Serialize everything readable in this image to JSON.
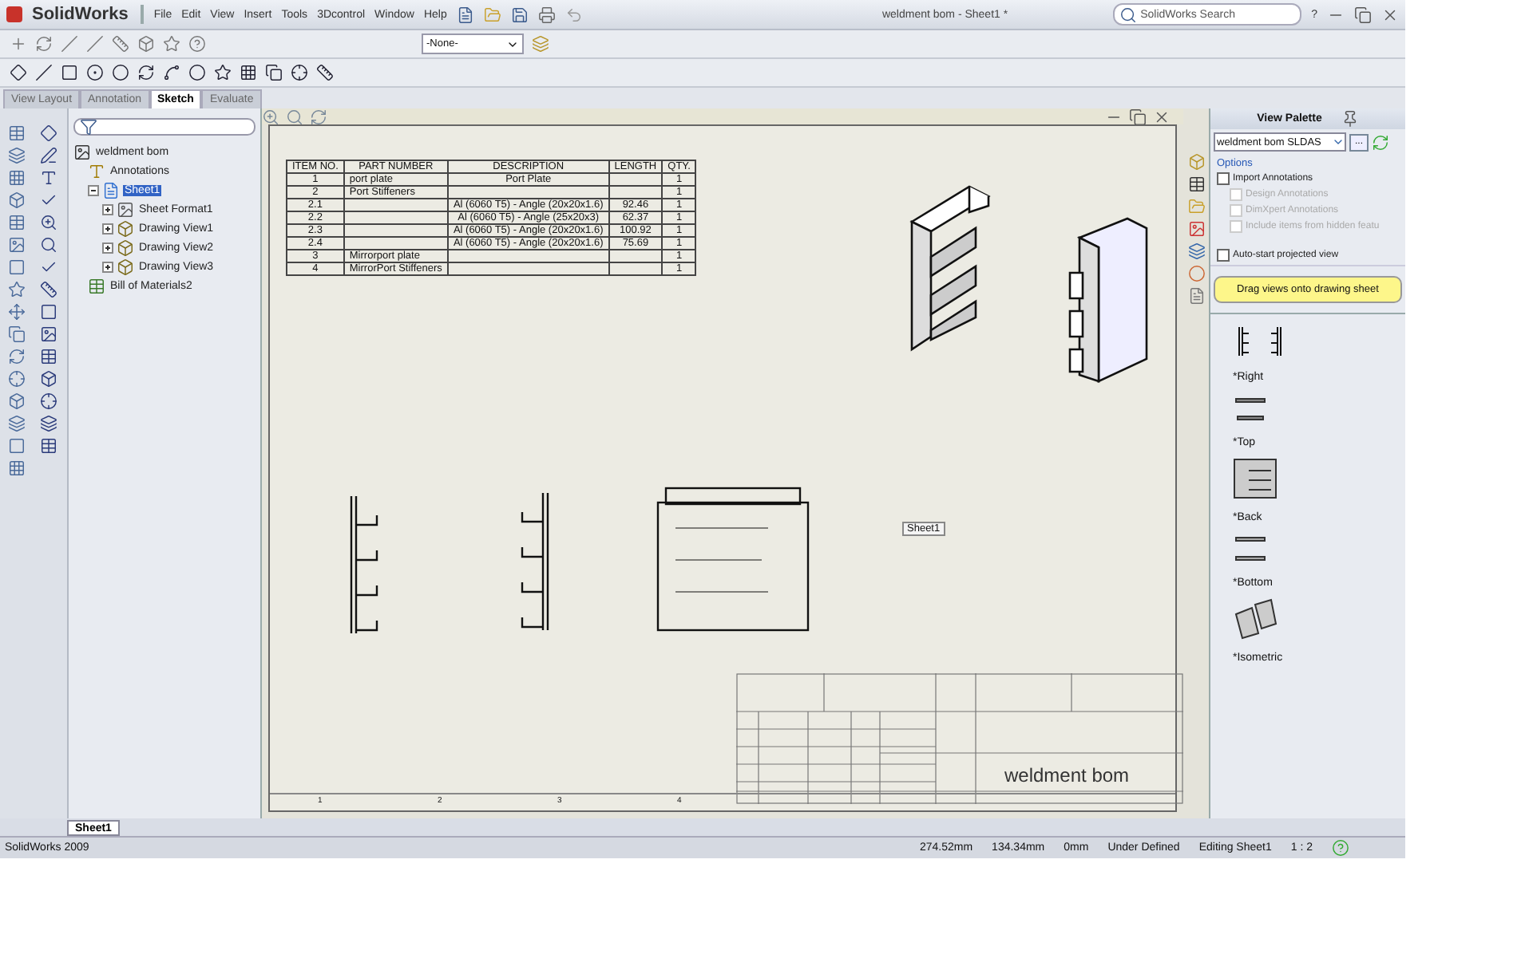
{
  "app": {
    "logo": "SolidWorks",
    "menus": [
      "File",
      "Edit",
      "View",
      "Insert",
      "Tools",
      "3Dcontrol",
      "Window",
      "Help"
    ],
    "document_title": "weldment bom - Sheet1 *",
    "search": {
      "placeholder": "SolidWorks Search"
    },
    "help": "?"
  },
  "layer_dropdown": {
    "value": "-None-"
  },
  "command_tabs": [
    {
      "label": "View Layout",
      "selected": false
    },
    {
      "label": "Annotation",
      "selected": false
    },
    {
      "label": "Sketch",
      "selected": true
    },
    {
      "label": "Evaluate",
      "selected": false
    }
  ],
  "feature_tree": {
    "root": "weldment bom",
    "items": [
      {
        "label": "Annotations",
        "kind": "annotations",
        "selected": false
      },
      {
        "label": "Sheet1",
        "kind": "sheet",
        "selected": true,
        "expanded": true,
        "children": [
          {
            "label": "Sheet Format1",
            "kind": "sheet_format",
            "selected": false,
            "expanded": false
          },
          {
            "label": "Drawing View1",
            "kind": "drawing_view",
            "selected": false,
            "expanded": false
          },
          {
            "label": "Drawing View2",
            "kind": "drawing_view",
            "selected": false,
            "expanded": false
          },
          {
            "label": "Drawing View3",
            "kind": "drawing_view",
            "selected": false,
            "expanded": false
          }
        ]
      },
      {
        "label": "Bill of Materials2",
        "kind": "bom",
        "selected": false
      }
    ]
  },
  "bom_table": {
    "columns": [
      "ITEM NO.",
      "PART NUMBER",
      "DESCRIPTION",
      "LENGTH",
      "QTY."
    ],
    "rows": [
      [
        "1",
        "port plate",
        "Port Plate",
        "",
        "1"
      ],
      [
        "2",
        "Port Stiffeners",
        "",
        "",
        "1"
      ],
      [
        "2.1",
        "",
        "Al (6060 T5) - Angle (20x20x1.6)",
        "92.46",
        "1"
      ],
      [
        "2.2",
        "",
        "Al (6060 T5) - Angle (25x20x3)",
        "62.37",
        "1"
      ],
      [
        "2.3",
        "",
        "Al (6060 T5) - Angle (20x20x1.6)",
        "100.92",
        "1"
      ],
      [
        "2.4",
        "",
        "Al (6060 T5) - Angle (20x20x1.6)",
        "75.69",
        "1"
      ],
      [
        "3",
        "Mirrorport plate",
        "",
        "",
        "1"
      ],
      [
        "4",
        "MirrorPort Stiffeners",
        "",
        "",
        "1"
      ]
    ]
  },
  "sheet_label": "Sheet1",
  "zone_labels": [
    "1",
    "2",
    "3",
    "4"
  ],
  "title_block": {
    "drawing_name": "weldment bom"
  },
  "view_palette": {
    "title": "View Palette",
    "file": "weldment bom SLDAS",
    "browse": "...",
    "options_heading": "Options",
    "options": [
      {
        "label": "Import Annotations",
        "checked": false,
        "disabled": false,
        "indented": false
      },
      {
        "label": "Design Annotations",
        "checked": false,
        "disabled": true,
        "indented": true
      },
      {
        "label": "DimXpert Annotations",
        "checked": false,
        "disabled": true,
        "indented": true
      },
      {
        "label": "Include items from hidden featu",
        "checked": false,
        "disabled": true,
        "indented": true
      },
      {
        "label": "Auto-start projected view",
        "checked": false,
        "disabled": false,
        "indented": false
      }
    ],
    "hint": "Drag views onto drawing sheet",
    "views": [
      {
        "label": "*Right",
        "kind": "right"
      },
      {
        "label": "*Top",
        "kind": "top"
      },
      {
        "label": "*Back",
        "kind": "back"
      },
      {
        "label": "*Bottom",
        "kind": "bottom"
      },
      {
        "label": "*Isometric",
        "kind": "isometric"
      }
    ]
  },
  "sheet_tabs": [
    {
      "label": "Sheet1",
      "selected": true
    }
  ],
  "status_bar": {
    "app": "SolidWorks 2009",
    "x": "274.52mm",
    "y": "134.34mm",
    "z": "0mm",
    "state": "Under Defined",
    "editing": "Editing Sheet1",
    "scale": "1 : 2"
  }
}
